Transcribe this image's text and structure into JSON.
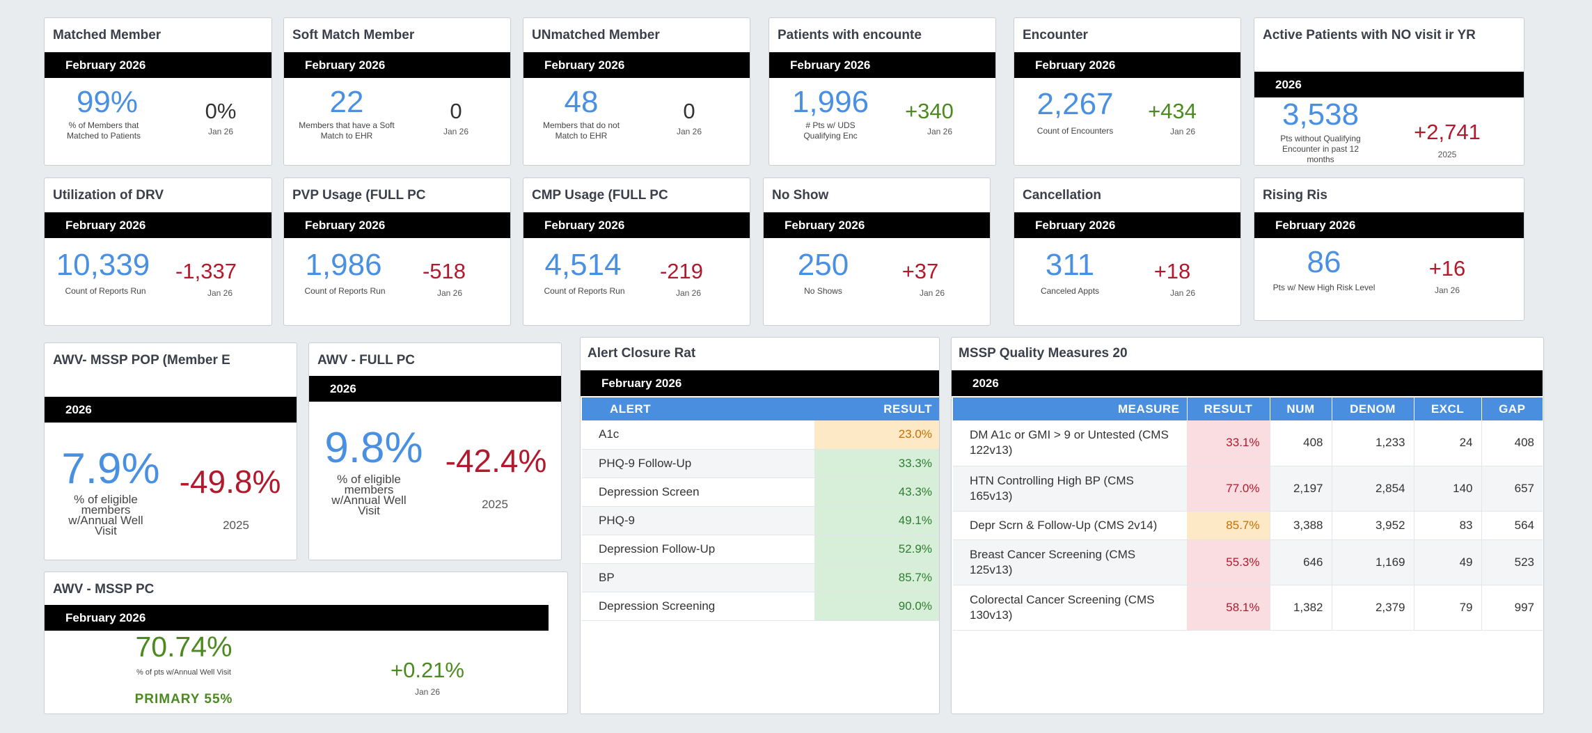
{
  "kpi_cards": [
    {
      "title": "Matched Member",
      "period": "February 2026",
      "value": "99%",
      "caption": "% of Members that Matched to Patients",
      "delta": "0%",
      "compare": "Jan 26"
    },
    {
      "title": "Soft Match Member",
      "period": "February 2026",
      "value": "22",
      "caption": "Members that have a Soft Match to EHR",
      "delta": "0",
      "compare": "Jan 26"
    },
    {
      "title": "UNmatched Member",
      "period": "February 2026",
      "value": "48",
      "caption": "Members that do not Match to EHR",
      "delta": "0",
      "compare": "Jan 26"
    },
    {
      "title": "Patients with encounte",
      "period": "February 2026",
      "value": "1,996",
      "caption": "# Pts w/ UDS Qualifying Enc",
      "delta": "+340",
      "compare": "Jan 26"
    },
    {
      "title": "Encounter",
      "period": "February 2026",
      "value": "2,267",
      "caption": "Count of Encounters",
      "delta": "+434",
      "compare": "Jan 26"
    },
    {
      "title": "Active Patients with NO visit ir YR",
      "period": "2026",
      "value": "3,538",
      "caption": "Pts without Qualifying Encounter in past 12 months",
      "delta": "+2,741",
      "compare": "2025"
    },
    {
      "title": "Utilization of DRV",
      "period": "February 2026",
      "value": "10,339",
      "caption": "Count of Reports Run",
      "delta": "-1,337",
      "compare": "Jan 26"
    },
    {
      "title": "PVP Usage (FULL PC",
      "period": "February 2026",
      "value": "1,986",
      "caption": "Count of Reports Run",
      "delta": "-518",
      "compare": "Jan 26"
    },
    {
      "title": "CMP Usage (FULL PC",
      "period": "February 2026",
      "value": "4,514",
      "caption": "Count of Reports Run",
      "delta": "-219",
      "compare": "Jan 26"
    },
    {
      "title": "No Show",
      "period": "February 2026",
      "value": "250",
      "caption": "No Shows",
      "delta": "+37",
      "compare": "Jan 26"
    },
    {
      "title": "Cancellation",
      "period": "February 2026",
      "value": "311",
      "caption": "Canceled Appts",
      "delta": "+18",
      "compare": "Jan 26"
    },
    {
      "title": "Rising Ris",
      "period": "February 2026",
      "value": "86",
      "caption": "Pts w/ New High Risk Level",
      "delta": "+16",
      "compare": "Jan 26"
    }
  ],
  "awv_pop": {
    "title": "AWV- MSSP POP (Member E",
    "period": "2026",
    "value": "7.9%",
    "caption": "% of eligible members w/Annual Well Visit",
    "delta": "-49.8%",
    "compare": "2025"
  },
  "awv_full": {
    "title": "AWV - FULL PC",
    "period": "2026",
    "value": "9.8%",
    "caption": "% of eligible members w/Annual Well Visit",
    "delta": "-42.4%",
    "compare": "2025"
  },
  "awv_mssp": {
    "title": "AWV - MSSP PC",
    "period": "February 2026",
    "value": "70.74%",
    "caption": "% of pts w/Annual Well Visit",
    "primary": "PRIMARY 55%",
    "delta": "+0.21%",
    "compare": "Jan 26"
  },
  "alert_closure": {
    "title": "Alert Closure Rat",
    "period": "February 2026",
    "headers": [
      "ALERT",
      "RESULT"
    ],
    "rows": [
      {
        "alert": "A1c",
        "result": "23.0%",
        "status": "warn"
      },
      {
        "alert": "PHQ-9 Follow-Up",
        "result": "33.3%",
        "status": "good"
      },
      {
        "alert": "Depression Screen",
        "result": "43.3%",
        "status": "good"
      },
      {
        "alert": "PHQ-9",
        "result": "49.1%",
        "status": "good"
      },
      {
        "alert": "Depression Follow-Up",
        "result": "52.9%",
        "status": "good"
      },
      {
        "alert": "BP",
        "result": "85.7%",
        "status": "good"
      },
      {
        "alert": "Depression Screening",
        "result": "90.0%",
        "status": "good"
      }
    ]
  },
  "quality": {
    "title": "MSSP Quality Measures 20",
    "period": "2026",
    "headers": [
      "MEASURE",
      "RESULT",
      "NUM",
      "DENOM",
      "EXCL",
      "GAP"
    ],
    "rows": [
      {
        "measure": "DM A1c or GMI > 9 or Untested (CMS 122v13)",
        "result": "33.1%",
        "status": "bad",
        "num": "408",
        "denom": "1,233",
        "excl": "24",
        "gap": "408"
      },
      {
        "measure": "HTN Controlling High BP (CMS 165v13)",
        "result": "77.0%",
        "status": "bad",
        "num": "2,197",
        "denom": "2,854",
        "excl": "140",
        "gap": "657"
      },
      {
        "measure": "Depr Scrn & Follow-Up (CMS 2v14)",
        "result": "85.7%",
        "status": "warn",
        "num": "3,388",
        "denom": "3,952",
        "excl": "83",
        "gap": "564"
      },
      {
        "measure": "Breast Cancer Screening (CMS 125v13)",
        "result": "55.3%",
        "status": "bad",
        "num": "646",
        "denom": "1,169",
        "excl": "49",
        "gap": "523"
      },
      {
        "measure": "Colorectal Cancer Screening (CMS 130v13)",
        "result": "58.1%",
        "status": "bad",
        "num": "1,382",
        "denom": "2,379",
        "excl": "79",
        "gap": "997"
      }
    ]
  },
  "colors": {
    "accent_blue": "#4a90e2",
    "positive": "#4a8a1f",
    "negative": "#b3192c",
    "band": "#000000",
    "table_header": "#4a8fdf"
  }
}
